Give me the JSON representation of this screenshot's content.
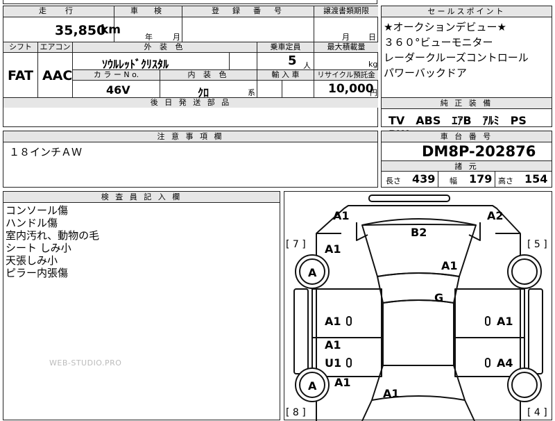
{
  "headers": {
    "mileage": "走　行",
    "inspection": "車　検",
    "registration_no": "登　録　番　号",
    "transfer_deadline": "譲渡書類期限",
    "sales_points": "セールスポイント",
    "shift": "シフト",
    "aircon": "エアコン",
    "exterior_color": "外 装 色",
    "capacity": "乗車定員",
    "max_load": "最大積載量",
    "color_no": "カ ラ ー N o.",
    "interior_color": "内 装 色",
    "import": "輸 入 車",
    "recycle": "リサイクル預託金",
    "later_parts": "後 日 発 送 部 品",
    "equipment": "純 正 装 備",
    "cautions": "注 意 事 項 欄",
    "chassis_no": "車 台 番 号",
    "specs": "諸 元",
    "inspector_notes": "検 査 員 記 入 欄"
  },
  "values": {
    "mileage": "35,850",
    "mileage_unit": "km",
    "inspection_year": "年",
    "inspection_month": "月",
    "transfer_month": "月",
    "transfer_day": "日",
    "shift": "FAT",
    "aircon": "AAC",
    "exterior_color": "ｿｳﾙﾚｯﾄﾞｸﾘｽﾀﾙ",
    "capacity": "5",
    "capacity_unit": "人",
    "max_load_unit": "kg",
    "color_no": "46V",
    "interior_color": "ｸﾛ",
    "interior_suffix": "系",
    "recycle": "10,000",
    "recycle_unit": "円",
    "equipment": "TV　ABS　ｴｱB　ｱﾙﾐ　PS　PW",
    "cautions": "１８インチＡＷ",
    "chassis_no": "DM8P-202876",
    "length_label": "長さ",
    "length": "439",
    "width_label": "幅",
    "width": "179",
    "height_label": "高さ",
    "height": "154"
  },
  "sales_points": [
    "★オークションデビュー★",
    "３６０°ビューモニター",
    "レーダークルーズコントロール",
    "パワーバックドア"
  ],
  "inspector_notes": [
    "コンソール傷",
    "ハンドル傷",
    "室内汚れ、動物の毛",
    "シート しみ小",
    "天張しみ小",
    "ピラー内張傷"
  ],
  "watermark": "WEB-STUDIO.PRO",
  "diagram": {
    "marks": [
      "A1",
      "A2",
      "B2",
      "A1",
      "A1",
      "A",
      "G",
      "A1",
      "A1",
      "A1",
      "U1",
      "A4",
      "A",
      "A1",
      "A1"
    ],
    "brackets": [
      "[ 7 ]",
      "[ 5 ]",
      "[ 8 ]",
      "[ 4 ]"
    ]
  }
}
